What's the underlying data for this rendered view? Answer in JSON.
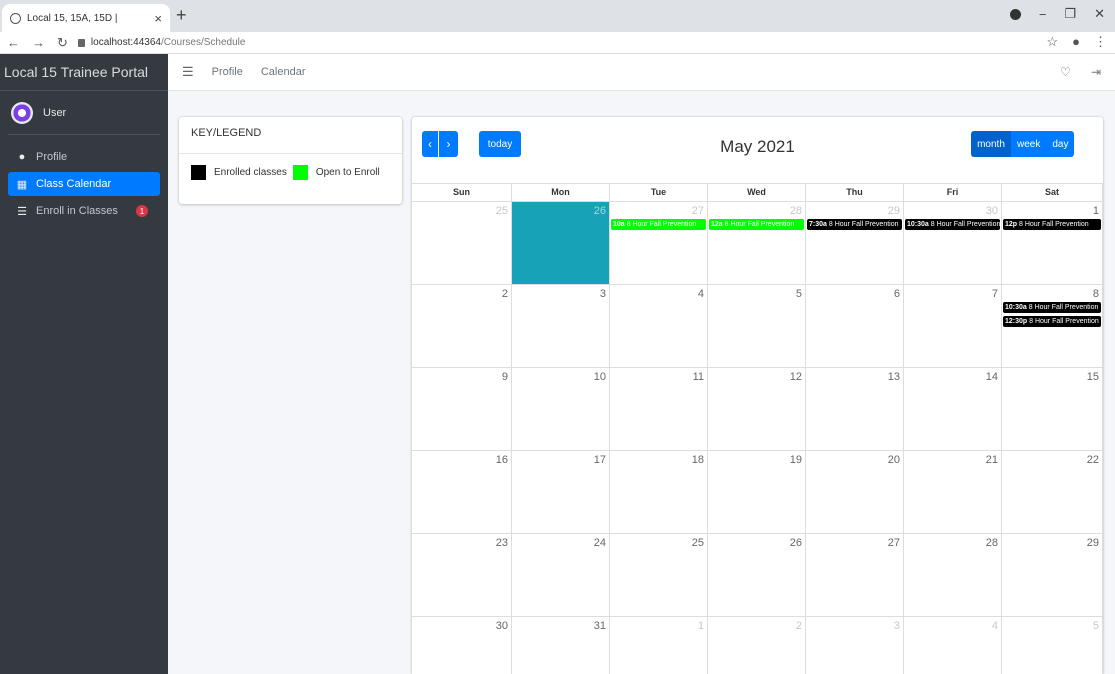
{
  "browser": {
    "tab_title": "Local 15, 15A, 15D |",
    "tab_close": "×",
    "new_tab": "+",
    "url_host": "localhost:44364",
    "url_path": "/Courses/Schedule"
  },
  "sidebar": {
    "brand": "Local 15 Trainee Portal",
    "user": "User",
    "items": [
      {
        "label": "Profile",
        "icon": "user-icon",
        "active": false
      },
      {
        "label": "Class Calendar",
        "icon": "calendar-icon",
        "active": true
      },
      {
        "label": "Enroll in Classes",
        "icon": "list-icon",
        "active": false,
        "badge": "1"
      }
    ]
  },
  "topnav": {
    "links": [
      "Profile",
      "Calendar"
    ]
  },
  "legend": {
    "title": "KEY/LEGEND",
    "enrolled_label": "Enrolled classes",
    "open_label": "Open to Enroll",
    "enrolled_color": "#000000",
    "open_color": "#00ff00"
  },
  "calendar": {
    "title": "May 2021",
    "today_label": "today",
    "views": [
      "month",
      "week",
      "day"
    ],
    "active_view": "month",
    "days_of_week": [
      "Sun",
      "Mon",
      "Tue",
      "Wed",
      "Thu",
      "Fri",
      "Sat"
    ],
    "weeks": [
      [
        {
          "n": "25",
          "other": true
        },
        {
          "n": "26",
          "other": true,
          "today": true
        },
        {
          "n": "27",
          "other": true
        },
        {
          "n": "28",
          "other": true
        },
        {
          "n": "29",
          "other": true
        },
        {
          "n": "30",
          "other": true
        },
        {
          "n": "1"
        }
      ],
      [
        {
          "n": "2"
        },
        {
          "n": "3"
        },
        {
          "n": "4"
        },
        {
          "n": "5"
        },
        {
          "n": "6"
        },
        {
          "n": "7"
        },
        {
          "n": "8"
        }
      ],
      [
        {
          "n": "9"
        },
        {
          "n": "10"
        },
        {
          "n": "11"
        },
        {
          "n": "12"
        },
        {
          "n": "13"
        },
        {
          "n": "14"
        },
        {
          "n": "15"
        }
      ],
      [
        {
          "n": "16"
        },
        {
          "n": "17"
        },
        {
          "n": "18"
        },
        {
          "n": "19"
        },
        {
          "n": "20"
        },
        {
          "n": "21"
        },
        {
          "n": "22"
        }
      ],
      [
        {
          "n": "23"
        },
        {
          "n": "24"
        },
        {
          "n": "25"
        },
        {
          "n": "26"
        },
        {
          "n": "27"
        },
        {
          "n": "28"
        },
        {
          "n": "29"
        }
      ],
      [
        {
          "n": "30"
        },
        {
          "n": "31"
        },
        {
          "n": "1",
          "other": true
        },
        {
          "n": "2",
          "other": true
        },
        {
          "n": "3",
          "other": true
        },
        {
          "n": "4",
          "other": true
        },
        {
          "n": "5",
          "other": true
        }
      ]
    ],
    "events": [
      {
        "week": 0,
        "day": 2,
        "slot": 0,
        "time": "10a",
        "title": "8 Hour Fall Prevention",
        "status": "open"
      },
      {
        "week": 0,
        "day": 3,
        "slot": 0,
        "time": "12a",
        "title": "8 Hour Fall Prevention",
        "status": "open"
      },
      {
        "week": 0,
        "day": 4,
        "slot": 0,
        "time": "7:30a",
        "title": "8 Hour Fall Prevention",
        "status": "enrolled"
      },
      {
        "week": 0,
        "day": 5,
        "slot": 0,
        "time": "10:30a",
        "title": "8 Hour Fall Prevention",
        "status": "enrolled"
      },
      {
        "week": 0,
        "day": 6,
        "slot": 0,
        "time": "12p",
        "title": "8 Hour Fall Prevention",
        "status": "enrolled"
      },
      {
        "week": 1,
        "day": 6,
        "slot": 0,
        "time": "10:30a",
        "title": "8 Hour Fall Prevention",
        "status": "enrolled"
      },
      {
        "week": 1,
        "day": 6,
        "slot": 1,
        "time": "12:30p",
        "title": "8 Hour Fall Prevention",
        "status": "enrolled"
      }
    ]
  }
}
